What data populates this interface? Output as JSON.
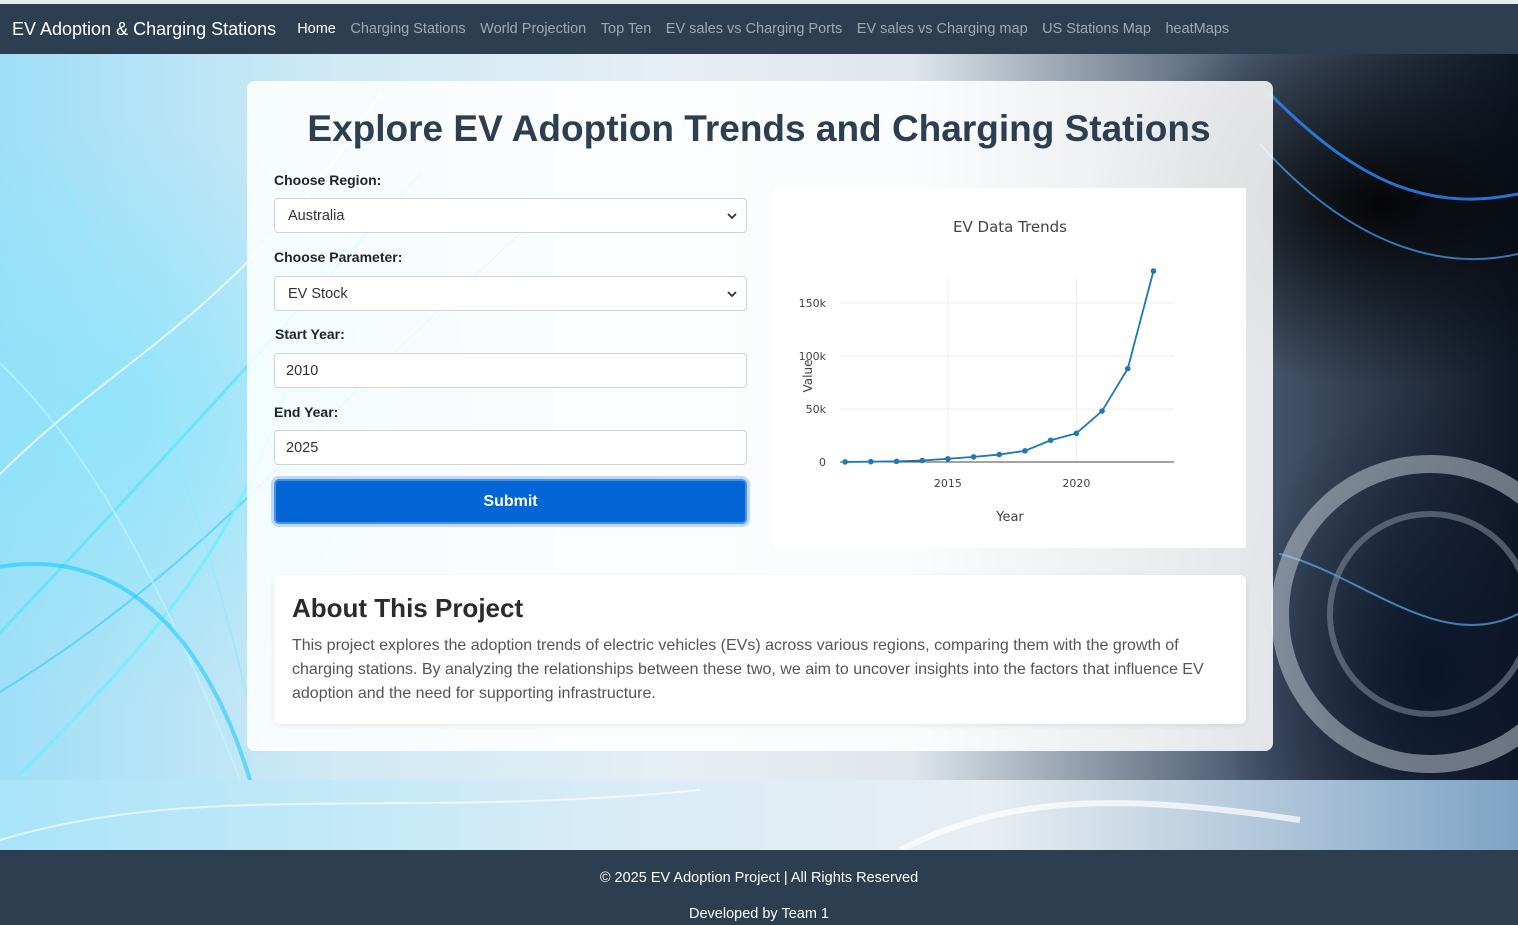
{
  "nav": {
    "brand": "EV Adoption & Charging Stations",
    "links": [
      "Home",
      "Charging Stations",
      "World Projection",
      "Top Ten",
      "EV sales vs Charging Ports",
      "EV sales vs Charging map",
      "US Stations Map",
      "heatMaps"
    ],
    "active": "Home"
  },
  "main": {
    "title": "Explore EV Adoption Trends and Charging Stations"
  },
  "form": {
    "region_label": "Choose Region:",
    "region_value": "Australia",
    "parameter_label": "Choose Parameter:",
    "parameter_value": "EV Stock",
    "start_label": "Start Year:",
    "start_value": "2010",
    "end_label": "End Year:",
    "end_value": "2025",
    "submit_label": "Submit"
  },
  "chart_data": {
    "type": "line",
    "title": "EV Data Trends",
    "xlabel": "Year",
    "ylabel": "Value",
    "x": [
      2011,
      2012,
      2013,
      2014,
      2015,
      2016,
      2017,
      2018,
      2019,
      2020,
      2021,
      2022,
      2023
    ],
    "series": [
      {
        "values": [
          49,
          300,
          600,
          1400,
          3000,
          4800,
          7000,
          10500,
          20500,
          27000,
          48000,
          88000,
          180000
        ]
      }
    ],
    "ylim": [
      0,
      180000
    ],
    "xlim": [
      2010.8,
      2023.8
    ],
    "xticks": [
      "2015",
      "2020"
    ],
    "yticks": [
      "0",
      "50k",
      "100k",
      "150k"
    ],
    "grid": true,
    "color": "#1f77b4"
  },
  "about": {
    "heading": "About This Project",
    "text": "This project explores the adoption trends of electric vehicles (EVs) across various regions, comparing them with the growth of charging stations. By analyzing the relationships between these two, we aim to uncover insights into the factors that influence EV adoption and the need for supporting infrastructure."
  },
  "footer": {
    "copyright": "© 2025 EV Adoption Project | All Rights Reserved",
    "developed": "Developed by Team 1"
  }
}
